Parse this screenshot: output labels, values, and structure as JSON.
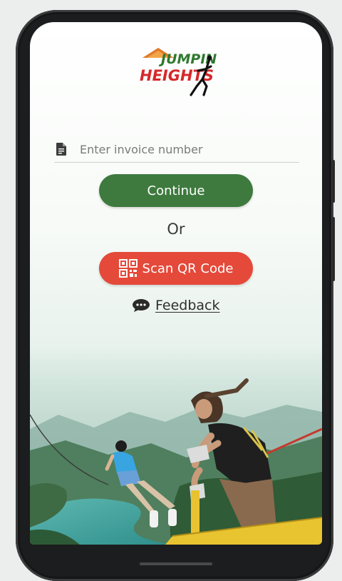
{
  "app": {
    "logo_text": [
      "JUMPIN",
      "HEIGHTS"
    ],
    "colors": {
      "continue": "#3e7a3e",
      "scan": "#e4493a",
      "logo_green": "#2f7a2f",
      "logo_red": "#d6282a"
    }
  },
  "invoice": {
    "icon": "document-icon",
    "placeholder": "Enter invoice number",
    "value": ""
  },
  "actions": {
    "continue_label": "Continue",
    "or_label": "Or",
    "scan_label": "Scan QR Code",
    "scan_icon": "qr-code-icon",
    "feedback_label": "Feedback",
    "feedback_icon": "chat-bubble-icon"
  },
  "hero": {
    "description_icon": "bungee-jump-scene"
  }
}
